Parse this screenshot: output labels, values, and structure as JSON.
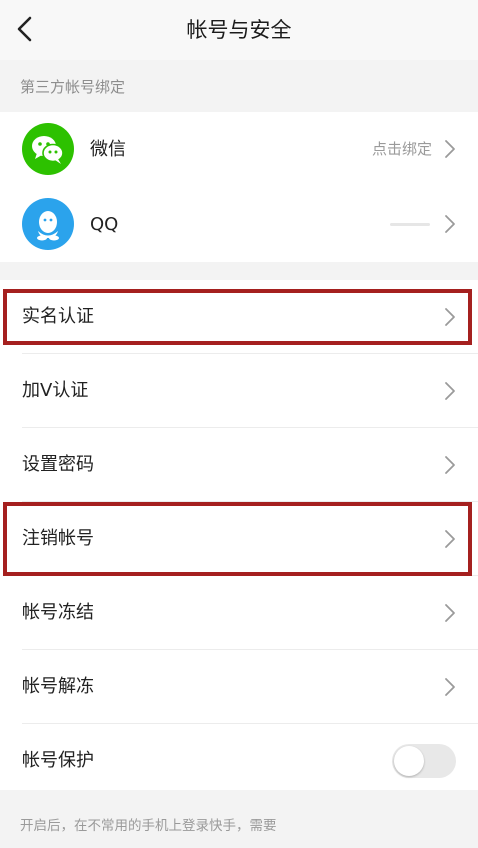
{
  "header": {
    "title": "帐号与安全"
  },
  "third_party": {
    "section_label": "第三方帐号绑定",
    "items": [
      {
        "name": "微信",
        "status": "点击绑定",
        "icon": "wechat-icon",
        "color": "#2dc100"
      },
      {
        "name": "QQ",
        "status": "",
        "icon": "qq-icon",
        "color": "#2ba3ec"
      }
    ]
  },
  "menu": {
    "items": [
      {
        "label": "实名认证",
        "highlighted": true
      },
      {
        "label": "加V认证",
        "highlighted": false
      },
      {
        "label": "设置密码",
        "highlighted": false
      },
      {
        "label": "注销帐号",
        "highlighted": true
      },
      {
        "label": "帐号冻结",
        "highlighted": false
      },
      {
        "label": "帐号解冻",
        "highlighted": false
      },
      {
        "label": "帐号保护",
        "toggle": false
      }
    ]
  },
  "footer": {
    "note": "开启后，在不常用的手机上登录快手，需要"
  },
  "colors": {
    "highlight": "#a5201f",
    "background": "#f3f3f3"
  }
}
